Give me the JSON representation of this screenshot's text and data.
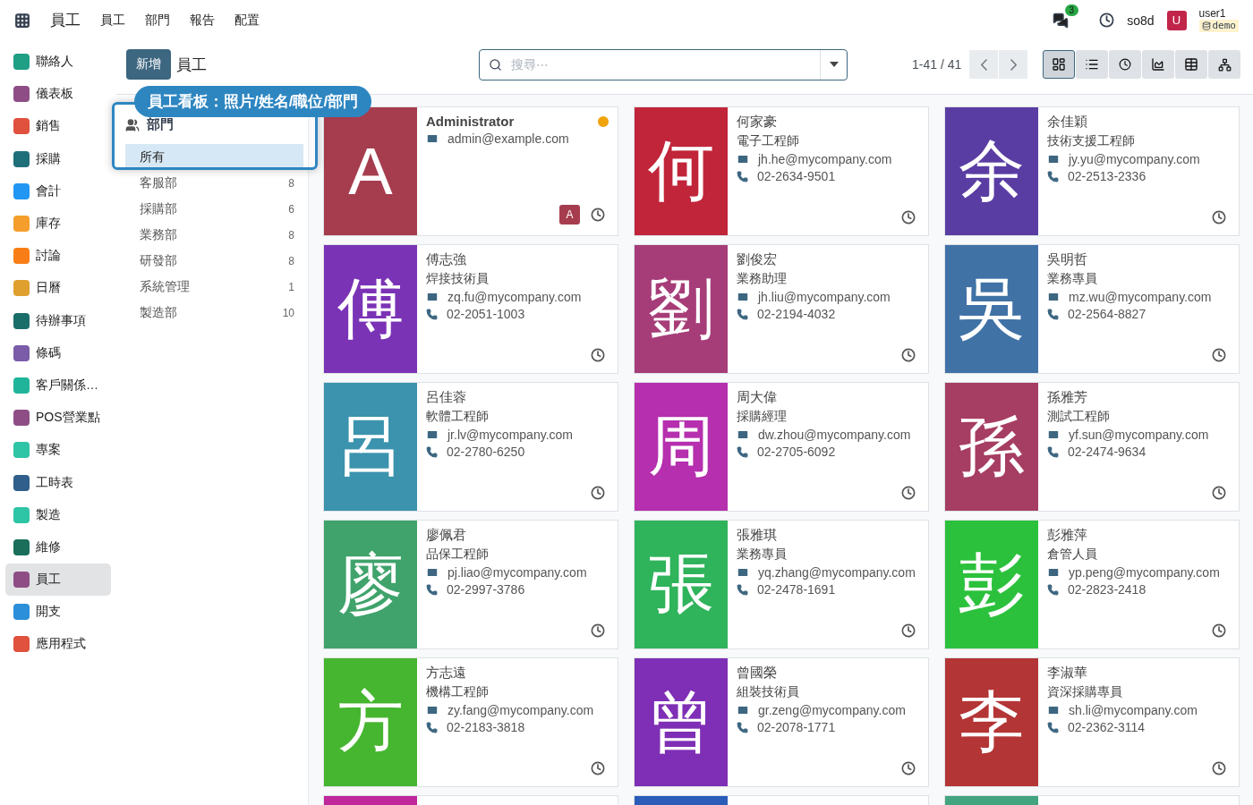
{
  "topbar": {
    "app": "員工",
    "menus": [
      "員工",
      "部門",
      "報告",
      "配置"
    ],
    "chat_count": "3",
    "company": "so8d",
    "avatar": "U",
    "user": "user1",
    "database": "demo"
  },
  "apps": [
    {
      "label": "聯絡人",
      "color": "#1f9f84",
      "selected": false
    },
    {
      "label": "儀表板",
      "color": "#8e4e85",
      "selected": false
    },
    {
      "label": "銷售",
      "color": "#e0513e",
      "selected": false
    },
    {
      "label": "採購",
      "color": "#1f6f7a",
      "selected": false
    },
    {
      "label": "會計",
      "color": "#2196f3",
      "selected": false
    },
    {
      "label": "庫存",
      "color": "#f59e2c",
      "selected": false
    },
    {
      "label": "討論",
      "color": "#f97d16",
      "selected": false
    },
    {
      "label": "日曆",
      "color": "#e0a030",
      "selected": false
    },
    {
      "label": "待辦事項",
      "color": "#1a6e6a",
      "selected": false
    },
    {
      "label": "條碼",
      "color": "#7a5ca8",
      "selected": false
    },
    {
      "label": "客戶關係…",
      "color": "#20b59a",
      "selected": false
    },
    {
      "label": "POS營業點",
      "color": "#8e4e85",
      "selected": false
    },
    {
      "label": "專案",
      "color": "#2ec4a6",
      "selected": false
    },
    {
      "label": "工時表",
      "color": "#2f5f8a",
      "selected": false
    },
    {
      "label": "製造",
      "color": "#2ec4a6",
      "selected": false
    },
    {
      "label": "維修",
      "color": "#1a6e5a",
      "selected": false
    },
    {
      "label": "員工",
      "color": "#8e4e85",
      "selected": true
    },
    {
      "label": "開支",
      "color": "#2b8fd9",
      "selected": false
    },
    {
      "label": "應用程式",
      "color": "#e0513e",
      "selected": false
    }
  ],
  "control": {
    "new_button": "新增",
    "title": "員工",
    "search_placeholder": "搜尋⋯",
    "pager": "1-41 / 41",
    "views": [
      {
        "kind": "kanban",
        "selected": true
      },
      {
        "kind": "list",
        "selected": false
      },
      {
        "kind": "activity",
        "selected": false
      },
      {
        "kind": "graph",
        "selected": false
      },
      {
        "kind": "pivot",
        "selected": false
      },
      {
        "kind": "hierarchy",
        "selected": false
      }
    ]
  },
  "departments": {
    "heading": "部門",
    "items": [
      {
        "label": "所有",
        "selected": true
      },
      {
        "label": "客服部",
        "count": "8",
        "selected": false
      },
      {
        "label": "採購部",
        "count": "6",
        "selected": false
      },
      {
        "label": "業務部",
        "count": "8",
        "selected": false
      },
      {
        "label": "研發部",
        "count": "8",
        "selected": false
      },
      {
        "label": "系統管理",
        "count": "1",
        "selected": false
      },
      {
        "label": "製造部",
        "count": "10",
        "selected": false
      }
    ]
  },
  "employees": [
    {
      "initial": "A",
      "name": "Administrator",
      "email": "admin@example.com",
      "color": "#a63d4e",
      "status": {
        "color": "#f0a30a"
      },
      "badge": "A"
    },
    {
      "initial": "何",
      "name": "何家豪",
      "job": "電子工程師",
      "email": "jh.he@mycompany.com",
      "phone": "02-2634-9501",
      "color": "#c1253a"
    },
    {
      "initial": "余",
      "name": "余佳穎",
      "job": "技術支援工程師",
      "email": "jy.yu@mycompany.com",
      "phone": "02-2513-2336",
      "color": "#5a3da3"
    },
    {
      "initial": "傅",
      "name": "傅志強",
      "job": "焊接技術員",
      "email": "zq.fu@mycompany.com",
      "phone": "02-2051-1003",
      "color": "#7b33b6"
    },
    {
      "initial": "劉",
      "name": "劉俊宏",
      "job": "業務助理",
      "email": "jh.liu@mycompany.com",
      "phone": "02-2194-4032",
      "color": "#a63d78"
    },
    {
      "initial": "吳",
      "name": "吳明哲",
      "job": "業務專員",
      "email": "mz.wu@mycompany.com",
      "phone": "02-2564-8827",
      "color": "#4072a6"
    },
    {
      "initial": "呂",
      "name": "呂佳蓉",
      "job": "軟體工程師",
      "email": "jr.lv@mycompany.com",
      "phone": "02-2780-6250",
      "color": "#3b93ad"
    },
    {
      "initial": "周",
      "name": "周大偉",
      "job": "採購經理",
      "email": "dw.zhou@mycompany.com",
      "phone": "02-2705-6092",
      "color": "#b52fae"
    },
    {
      "initial": "孫",
      "name": "孫雅芳",
      "job": "測試工程師",
      "email": "yf.sun@mycompany.com",
      "phone": "02-2474-9634",
      "color": "#a63d62"
    },
    {
      "initial": "廖",
      "name": "廖佩君",
      "job": "品保工程師",
      "email": "pj.liao@mycompany.com",
      "phone": "02-2997-3786",
      "color": "#3fa36b"
    },
    {
      "initial": "張",
      "name": "張雅琪",
      "job": "業務專員",
      "email": "yq.zhang@mycompany.com",
      "phone": "02-2478-1691",
      "color": "#2fb35b"
    },
    {
      "initial": "彭",
      "name": "彭雅萍",
      "job": "倉管人員",
      "email": "yp.peng@mycompany.com",
      "phone": "02-2823-2418",
      "color": "#2cc13c"
    },
    {
      "initial": "方",
      "name": "方志遠",
      "job": "機構工程師",
      "email": "zy.fang@mycompany.com",
      "phone": "02-2183-3818",
      "color": "#46b52f"
    },
    {
      "initial": "曾",
      "name": "曾國榮",
      "job": "組裝技術員",
      "email": "gr.zeng@mycompany.com",
      "phone": "02-2078-1771",
      "color": "#7f2fb5"
    },
    {
      "initial": "李",
      "name": "李淑華",
      "job": "資深採購專員",
      "email": "sh.li@mycompany.com",
      "phone": "02-2362-3114",
      "color": "#b43535"
    }
  ],
  "partial_cards": [
    {
      "color": "#c0279b"
    },
    {
      "color": "#2a5cb8"
    },
    {
      "color": "#43a57f"
    }
  ],
  "annotation": "員工看板：照片/姓名/職位/部門"
}
